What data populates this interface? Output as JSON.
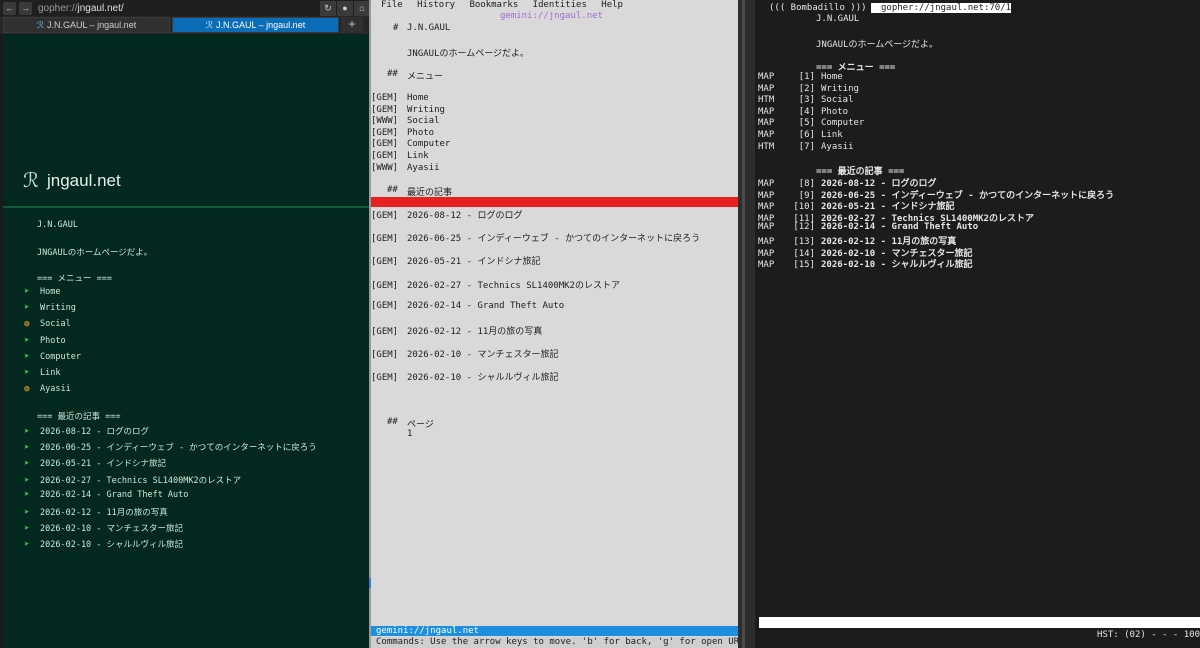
{
  "browser": {
    "url_scheme": "gopher://",
    "url_host": "jngaul.net/",
    "tabs": [
      {
        "label": "J.N.GAUL – jngaul.net",
        "active": false
      },
      {
        "label": "J.N.GAUL – jngaul.net",
        "active": true
      }
    ],
    "site_title": "jngaul.net",
    "heading": "J.N.GAUL",
    "intro": "JNGAULのホームページだよ。",
    "menu_heading": "=== メニュー ===",
    "menu": [
      {
        "icon": "arrow",
        "label": "Home"
      },
      {
        "icon": "arrow",
        "label": "Writing"
      },
      {
        "icon": "globe",
        "label": "Social"
      },
      {
        "icon": "arrow",
        "label": "Photo"
      },
      {
        "icon": "arrow",
        "label": "Computer"
      },
      {
        "icon": "arrow",
        "label": "Link"
      },
      {
        "icon": "globe",
        "label": "Ayasii"
      }
    ],
    "articles_heading": "=== 最近の記事 ===",
    "articles": [
      "2026-08-12 - ログのログ",
      "2026-06-25 - インディーウェブ - かつてのインターネットに戻ろう",
      "2026-05-21 - インドシナ旅記",
      "2026-02-27 - Technics SL1400MK2のレストア",
      "2026-02-14 - Grand Theft Auto",
      "2026-02-12 - 11月の旅の写真",
      "2026-02-10 - マンチェスター旅記",
      "2026-02-10 - シャルルヴィル旅記"
    ]
  },
  "gemini": {
    "menubar": [
      "File",
      "History",
      "Bookmarks",
      "Identities",
      "Help"
    ],
    "url": "gemini://jngaul.net",
    "h1_marker": "#",
    "heading": "J.N.GAUL",
    "intro": "JNGAULのホームページだよ。",
    "h2_marker": "##",
    "menu_heading": "メニュー",
    "menu": [
      {
        "tag": "[GEM]",
        "label": "Home"
      },
      {
        "tag": "[GEM]",
        "label": "Writing"
      },
      {
        "tag": "[WWW]",
        "label": "Social"
      },
      {
        "tag": "[GEM]",
        "label": "Photo"
      },
      {
        "tag": "[GEM]",
        "label": "Computer"
      },
      {
        "tag": "[GEM]",
        "label": "Link"
      },
      {
        "tag": "[WWW]",
        "label": "Ayasii"
      }
    ],
    "articles_heading": "最近の記事",
    "articles": [
      {
        "tag": "[GEM]",
        "label": "2026-08-12 - ログのログ"
      },
      {
        "tag": "[GEM]",
        "label": "2026-06-25 - インディーウェブ - かつてのインターネットに戻ろう"
      },
      {
        "tag": "[GEM]",
        "label": "2026-05-21 - インドシナ旅記"
      },
      {
        "tag": "[GEM]",
        "label": "2026-02-27 - Technics SL1400MK2のレストア"
      },
      {
        "tag": "[GEM]",
        "label": "2026-02-14 - Grand Theft Auto"
      },
      {
        "tag": "[GEM]",
        "label": "2026-02-12 - 11月の旅の写真"
      },
      {
        "tag": "[GEM]",
        "label": "2026-02-10 - マンチェスター旅記"
      },
      {
        "tag": "[GEM]",
        "label": "2026-02-10 - シャルルヴィル旅記"
      }
    ],
    "page_heading": "ページ",
    "page_number": "1",
    "status_url": "gemini://jngaul.net",
    "commands": "Commands: Use the arrow keys to move. 'b' for back, 'g' for open URL,"
  },
  "bombadillo": {
    "title": "((( Bombadillo )))",
    "address": "gopher://jngaul.net:70/1/",
    "heading": "J.N.GAUL",
    "intro": "JNGAULのホームページだよ。",
    "menu_heading": "=== メニュー ===",
    "menu": [
      {
        "type": "MAP",
        "index": "[1]",
        "label": "Home"
      },
      {
        "type": "MAP",
        "index": "[2]",
        "label": "Writing"
      },
      {
        "type": "HTM",
        "index": "[3]",
        "label": "Social"
      },
      {
        "type": "MAP",
        "index": "[4]",
        "label": "Photo"
      },
      {
        "type": "MAP",
        "index": "[5]",
        "label": "Computer"
      },
      {
        "type": "MAP",
        "index": "[6]",
        "label": "Link"
      },
      {
        "type": "HTM",
        "index": "[7]",
        "label": "Ayasii"
      }
    ],
    "articles_heading": "=== 最近の記事 ===",
    "articles": [
      {
        "type": "MAP",
        "index": "[8]",
        "label": "2026-08-12 - ログのログ"
      },
      {
        "type": "MAP",
        "index": "[9]",
        "label": "2026-06-25 - インディーウェブ - かつてのインターネットに戻ろう"
      },
      {
        "type": "MAP",
        "index": "[10]",
        "label": "2026-05-21 - インドシナ旅記"
      },
      {
        "type": "MAP",
        "index": "[11]",
        "label": "2026-02-27 - Technics SL1400MK2のレストア"
      },
      {
        "type": "MAP",
        "index": "[12]",
        "label": "2026-02-14 - Grand Theft Auto"
      },
      {
        "type": "MAP",
        "index": "[13]",
        "label": "2026-02-12 - 11月の旅の写真"
      },
      {
        "type": "MAP",
        "index": "[14]",
        "label": "2026-02-10 - マンチェスター旅記"
      },
      {
        "type": "MAP",
        "index": "[15]",
        "label": "2026-02-10 - シャルルヴィル旅記"
      }
    ],
    "status": "HST: (02) - - - 100"
  },
  "colors": {
    "site_bg": "#03281f",
    "arrow": "#3ad14a",
    "active_tab": "#0b6cb8",
    "selection_bar": "#e82020",
    "status_bar": "#1e8fdc"
  }
}
